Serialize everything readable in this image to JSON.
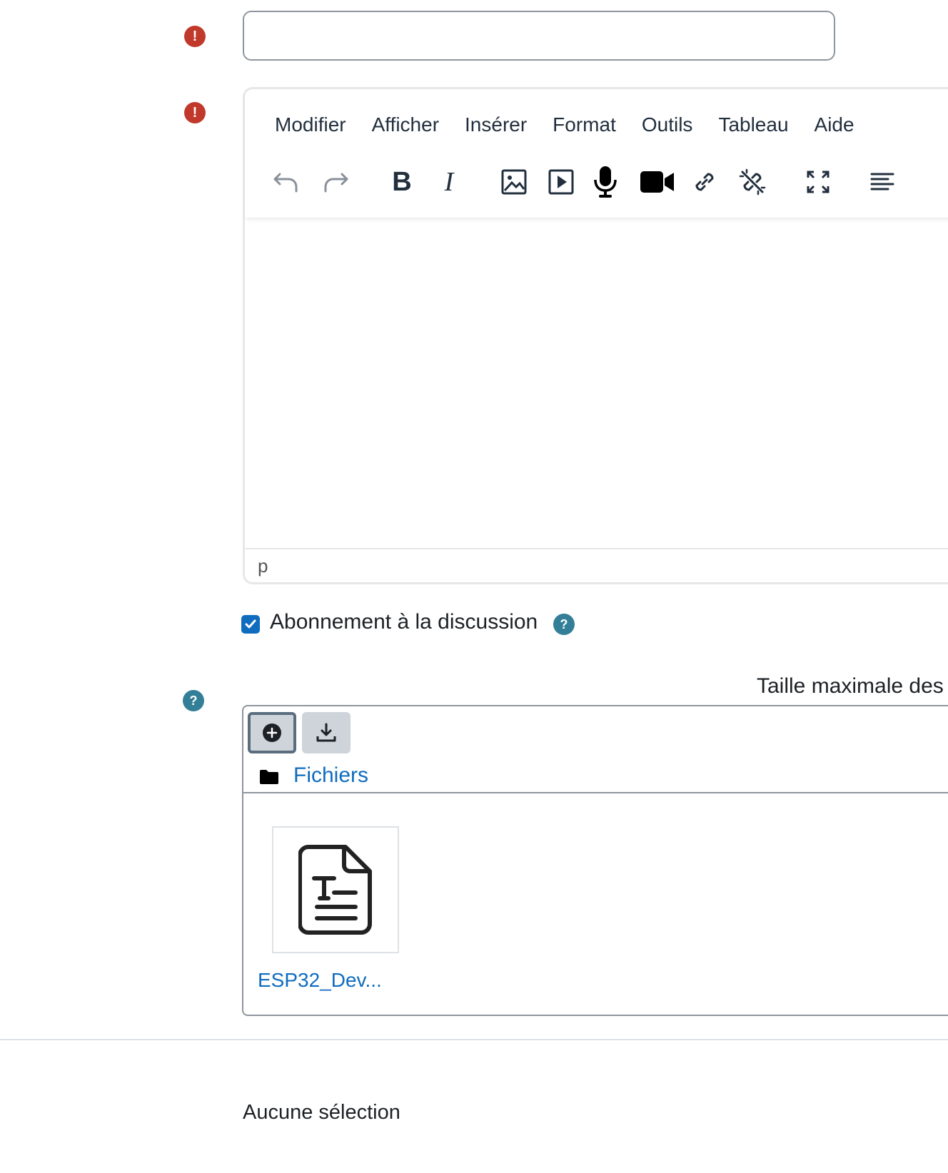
{
  "form": {
    "subject_input": {
      "value": "",
      "placeholder": ""
    },
    "subscription": {
      "label": "Abonnement à la discussion",
      "checked": true
    },
    "max_size_label": "Taille maximale des"
  },
  "editor": {
    "menu": [
      "Modifier",
      "Afficher",
      "Insérer",
      "Format",
      "Outils",
      "Tableau",
      "Aide"
    ],
    "toolbar_icons": [
      "undo-icon",
      "redo-icon",
      "bold-icon",
      "italic-icon",
      "image-icon",
      "media-icon",
      "microphone-icon",
      "video-camera-icon",
      "link-icon",
      "unlink-icon",
      "fullscreen-icon",
      "align-left-icon"
    ],
    "content": "",
    "statusbar_path": "p"
  },
  "filemanager": {
    "folder_label": "Fichiers",
    "files": [
      {
        "name": "ESP32_Dev..."
      }
    ]
  },
  "footer": {
    "selection_text": "Aucune sélection"
  },
  "colors": {
    "error": "#c0392b",
    "help": "#327f97",
    "link": "#0f6cbf",
    "checkbox": "#0f6cbf"
  }
}
